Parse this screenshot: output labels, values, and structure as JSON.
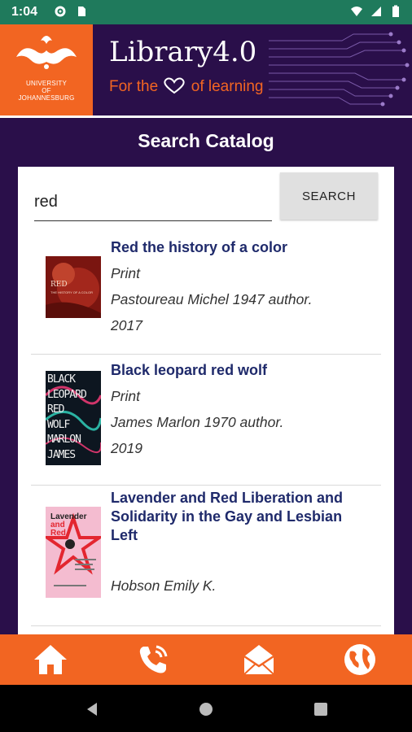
{
  "status": {
    "time": "1:04"
  },
  "header": {
    "brand": "Library4.0",
    "tagline_prefix": "For the",
    "tagline_suffix": "of learning",
    "university_line1": "UNIVERSITY",
    "university_line2": "OF",
    "university_line3": "JOHANNESBURG"
  },
  "page": {
    "title": "Search Catalog"
  },
  "search": {
    "value": "red",
    "button_label": "SEARCH"
  },
  "results": [
    {
      "title": "Red the history of a color",
      "format": "Print",
      "author": "Pastoureau Michel 1947 author.",
      "year": "2017"
    },
    {
      "title": "Black leopard red wolf",
      "format": "Print",
      "author": "James Marlon 1970 author.",
      "year": "2019"
    },
    {
      "title": "Lavender and Red Liberation and Solidarity in the Gay and Lesbian Left",
      "format": "",
      "author": "Hobson Emily K.",
      "year": ""
    }
  ],
  "covers": {
    "book1": {
      "top": "RED",
      "sub": "THE HISTORY OF A COLOR"
    },
    "book2": {
      "lines": [
        "BLACK",
        "LEOPARD",
        "RED",
        "WOLF",
        "MARLON",
        "JAMES"
      ]
    },
    "book3": {
      "line1": "Lavender",
      "line2": "and",
      "line3": "Red"
    }
  },
  "bottom_nav": [
    "home-icon",
    "phone-icon",
    "mail-icon",
    "globe-icon"
  ],
  "colors": {
    "accent": "#f26522",
    "purple": "#2a0f4a",
    "title_blue": "#1f2a6b",
    "status_green": "#1f7a5c"
  }
}
